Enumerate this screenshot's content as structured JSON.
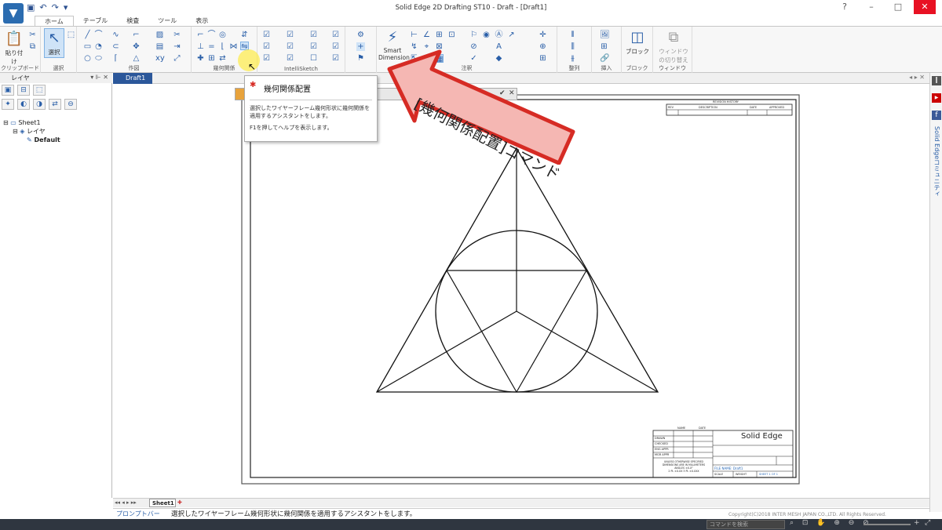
{
  "window_title": "Solid Edge 2D Drafting ST10 - Draft - [Draft1]",
  "ribbon_tabs": [
    "ホーム",
    "テーブル",
    "検査",
    "ツール",
    "表示"
  ],
  "ribbon_groups": {
    "clipboard": "クリップボード",
    "select": "選択",
    "draw": "作図",
    "relate": "幾何関係",
    "intellisketch": "IntelliSketch",
    "annotation": "注釈",
    "align": "整列",
    "insert": "挿入",
    "block": "ブロック",
    "window": "ウィンドウ"
  },
  "ribbon_buttons": {
    "paste": "貼り付け",
    "select": "選択",
    "smart_dimension": "Smart Dimension",
    "block": "ブロック",
    "window_switch": "ウィンドウの切り替え"
  },
  "left_panel": {
    "title": "レイヤ",
    "tree": [
      "Sheet1",
      "レイヤ",
      "Default"
    ]
  },
  "doc_tab": "Draft1",
  "sheet_tab": "Sheet1",
  "tooltip": {
    "title": "幾何関係配置",
    "description": "選択したワイヤーフレーム幾何形状に幾何関係を適用するアシスタントをします。",
    "help": "F1を押してヘルプを表示します。"
  },
  "callout": "[幾何関係配置]コマンド",
  "prompt_bar_label": "プロンプトバー",
  "prompt_text": "選択したワイヤーフレーム幾何形状に幾何関係を適用するアシスタントをします。",
  "command_search_placeholder": "コマンドを検索",
  "copyright": "Copyright(C)2018 INTER MESH JAPAN CO.,LTD. All Rights Reserved.",
  "right_sidebar_label": "Solid Edgeコミュニティ",
  "title_block": {
    "revision_history": "REVISION HISTORY",
    "rev_headers": [
      "REV",
      "DESCRIPTION",
      "DATE",
      "APPROVED"
    ],
    "rows": [
      "DRAWN",
      "CHECKED",
      "ENG APPR",
      "MGR APPR"
    ],
    "name_header": "NAME",
    "date_header": "DATE",
    "company": "Solid Edge",
    "file_name": "FILE NAME: Draft1",
    "sheet": "SHEET 1 OF 1",
    "scale": "SCALE",
    "weight": "WEIGHT",
    "notes": [
      "UNLESS OTHERWISE SPECIFIED",
      "DIMENSIONS ARE IN MILLIMETERS",
      "ANGLES ±X.X°",
      "2 PL ±X.XX  3 PL ±X.XXX"
    ]
  },
  "colors": {
    "accent": "#2b579a",
    "callout_fill": "#f5b7b3",
    "callout_stroke": "#d62b24",
    "highlight": "#ffeb3b"
  }
}
